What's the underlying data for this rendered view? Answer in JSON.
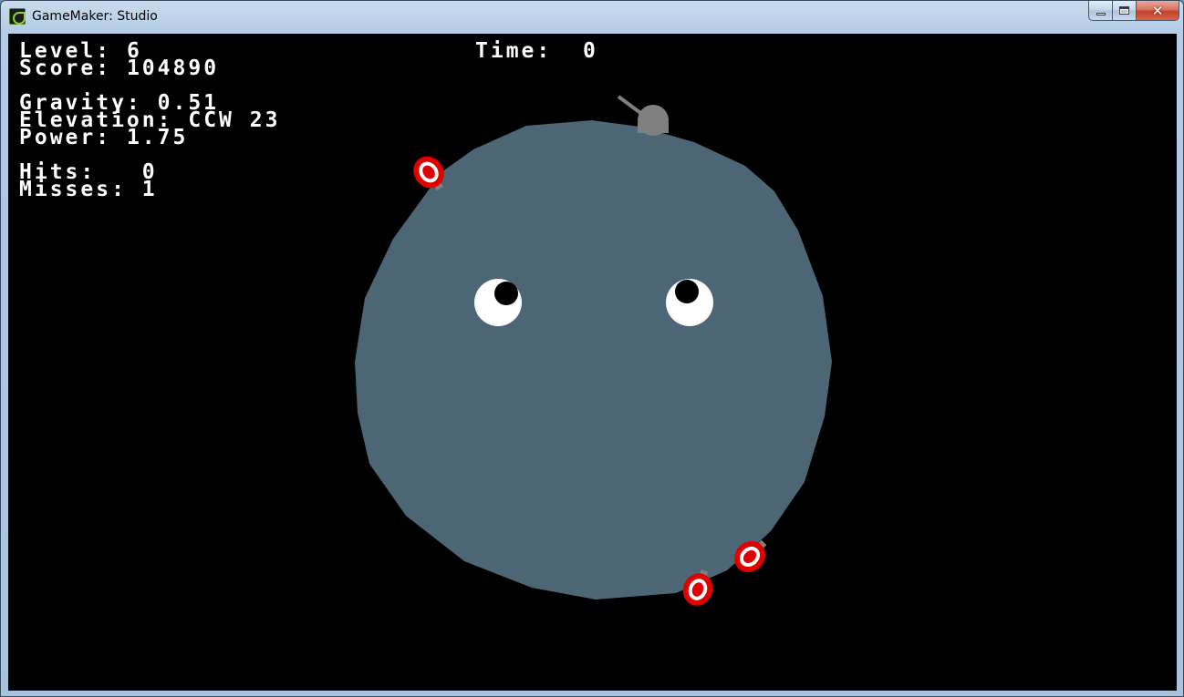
{
  "window": {
    "title": "GameMaker: Studio",
    "controls": {
      "minimize": "minimize",
      "maximize": "maximize",
      "close": "✕"
    }
  },
  "hud": {
    "level_label": "Level:",
    "level_value": "6",
    "score_label": "Score:",
    "score_value": "104890",
    "time_label": "Time:",
    "time_value": "0",
    "gravity_label": "Gravity:",
    "gravity_value": "0.51",
    "elevation_label": "Elevation:",
    "elevation_value": "CCW 23",
    "power_label": "Power:",
    "power_value": "1.75",
    "hits_label": "Hits:",
    "hits_value": "0",
    "misses_label": "Misses:",
    "misses_value": "1"
  },
  "colors": {
    "planet": "#4d6675",
    "background": "#000000",
    "target_red": "#e00000",
    "cannon_gray": "#808080",
    "eye_white": "#ffffff",
    "pupil": "#000000"
  },
  "icons": {
    "app": "gamemaker-logo-icon",
    "minimize": "minimize-icon",
    "maximize": "maximize-icon",
    "close": "close-icon"
  }
}
